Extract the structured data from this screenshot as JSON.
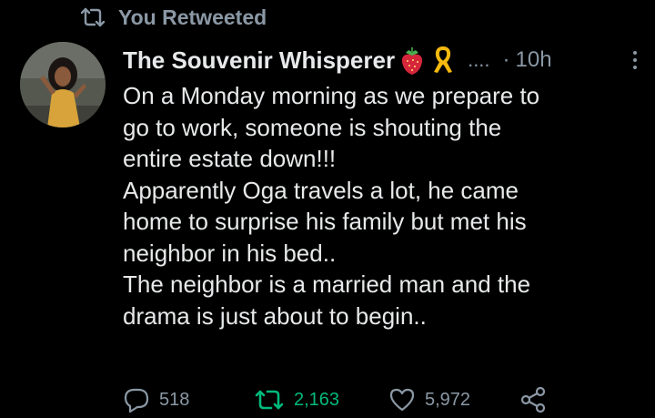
{
  "retweet_context": {
    "label": "You Retweeted",
    "icon": "retweet-icon"
  },
  "tweet": {
    "author": {
      "display_name": "The Souvenir Whisperer",
      "badges": [
        "strawberry-icon",
        "awareness-ribbon-icon"
      ],
      "truncation": "...."
    },
    "separator": "·",
    "timestamp": "10h",
    "text_lines": [
      "On a Monday morning as we prepare to",
      "go to work, someone is shouting the",
      "entire estate down!!!",
      "Apparently Oga travels a lot, he came",
      "home to surprise his family but met his",
      "neighbor in his bed..",
      "The neighbor is a married man and the",
      "drama is just about to begin.."
    ],
    "actions": {
      "replies": "518",
      "retweets": "2,163",
      "likes": "5,972"
    }
  },
  "colors": {
    "background": "#000000",
    "text_primary": "#e7e9ea",
    "text_secondary": "#8b98a5",
    "retweet_active": "#00ba7c"
  }
}
